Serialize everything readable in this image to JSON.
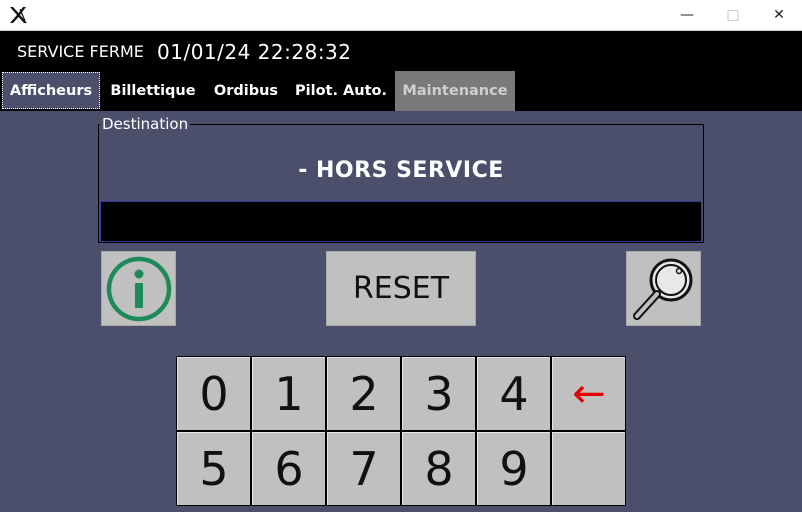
{
  "window": {
    "icon": "x-logo-icon",
    "minimize_symbol": "—",
    "maximize_symbol": "□",
    "close_symbol": "✕"
  },
  "header": {
    "status": "SERVICE FERME",
    "datetime": "01/01/24 22:28:32"
  },
  "tabs": [
    {
      "label": "Afficheurs",
      "active": true
    },
    {
      "label": "Billettique",
      "active": false
    },
    {
      "label": "Ordibus",
      "active": false
    },
    {
      "label": "Pilot. Auto.",
      "active": false
    },
    {
      "label": "Maintenance",
      "active": false,
      "disabled": true
    }
  ],
  "destination": {
    "legend": "Destination",
    "current": "- HORS SERVICE",
    "input_value": ""
  },
  "actions": {
    "info_icon": "info-icon",
    "reset_label": "RESET",
    "search_icon": "magnifier-icon"
  },
  "keypad": {
    "row1": [
      "0",
      "1",
      "2",
      "3",
      "4",
      "←"
    ],
    "row2": [
      "5",
      "6",
      "7",
      "8",
      "9",
      ""
    ]
  },
  "colors": {
    "background": "#4b4f6b",
    "topbar": "#000000",
    "button": "#c0c0c0",
    "info_icon": "#1e8a5a",
    "backspace": "#e00000",
    "maintenance_tab": "#7a7a7a"
  }
}
